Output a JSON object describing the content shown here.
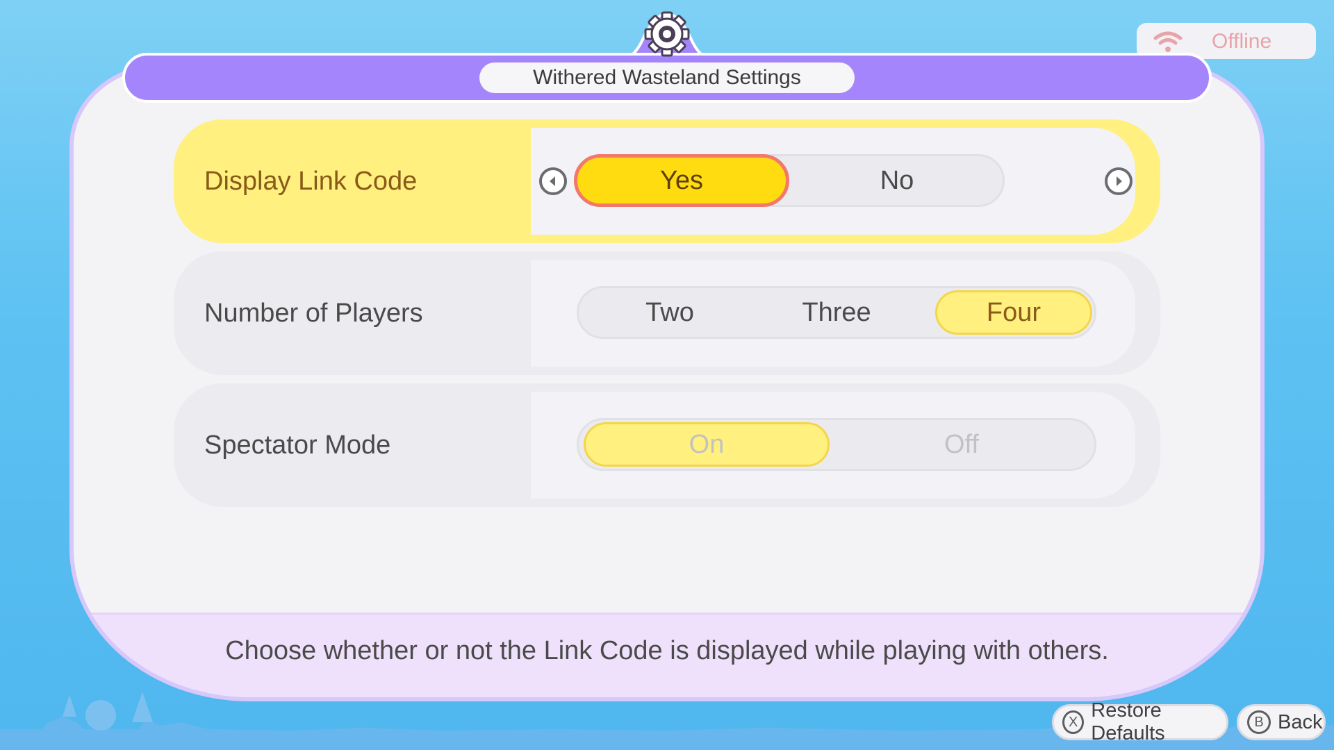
{
  "status": {
    "connection_label": "Offline"
  },
  "header": {
    "title": "Withered Wasteland Settings",
    "icon": "gear-icon"
  },
  "settings": [
    {
      "label": "Display Link Code",
      "options": [
        "Yes",
        "No"
      ],
      "selected": "Yes"
    },
    {
      "label": "Number of Players",
      "options": [
        "Two",
        "Three",
        "Four"
      ],
      "selected": "Four"
    },
    {
      "label": "Spectator Mode",
      "options": [
        "On",
        "Off"
      ],
      "selected": "On"
    }
  ],
  "description": "Choose whether or not the Link Code is displayed while playing with others.",
  "footer": {
    "restore_glyph": "X",
    "restore_label": "Restore Defaults",
    "back_glyph": "B",
    "back_label": "Back"
  },
  "colors": {
    "accent_purple": "#a585fb",
    "highlight_yellow": "#fff07f",
    "selected_yellow": "#ffdc10",
    "selection_border": "#f3786c"
  }
}
